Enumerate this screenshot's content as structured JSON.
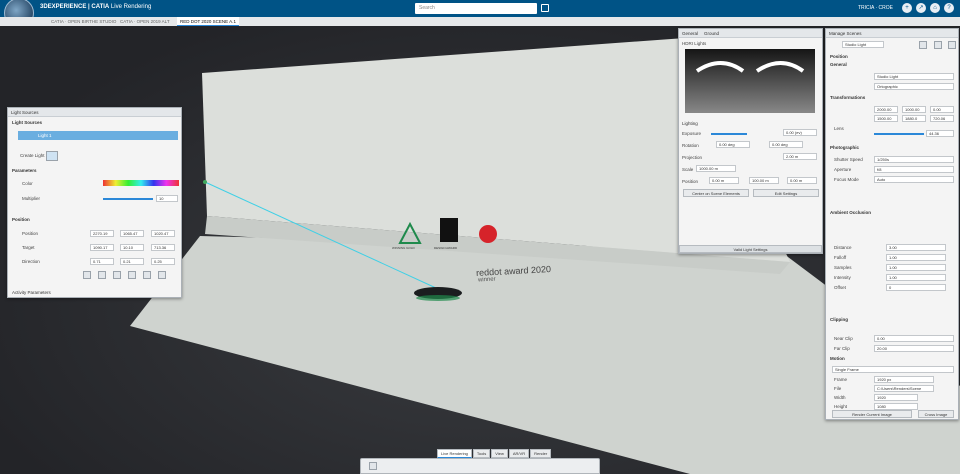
{
  "app": {
    "brand": "3DEXPERIENCE | CATIA",
    "module": "Live Rendering",
    "search_placeholder": "Search",
    "user_name": "TRICIA · CROE"
  },
  "tabs": [
    {
      "label": "CATIA · OPEN BIRTHE STUDIO"
    },
    {
      "label": "CATIA · OPEN 2019 ALT"
    },
    {
      "label": "RED DOT 2020 SCENE A.1",
      "active": true
    }
  ],
  "scene": {
    "reddot_brand": "reddot award 2020",
    "reddot_sub": "winner",
    "logo1_caption": "WINNING GOLD",
    "logo2_caption": "DESIGN AWARD"
  },
  "light_panel": {
    "title": "Light Sources",
    "section": "Light Sources",
    "light_name": "Light 1",
    "create_light_label": "Create Light",
    "parameters_heading": "Parameters",
    "color_label": "Color",
    "multiplier_label": "Multiplier",
    "multiplier_value": "10",
    "position_heading": "Position",
    "position_label": "Position",
    "target_label": "Target",
    "direction_label": "Direction",
    "position_values": [
      "2270.19",
      "1065.47",
      "1020.47"
    ],
    "target_values": [
      "1090.17",
      "10.10",
      "713.36"
    ],
    "direction_values": [
      "0.71",
      "0.21",
      "0.25"
    ],
    "advanced_heading": "Activity Parameters"
  },
  "env_panel": {
    "tab1": "General",
    "tab2": "Ground",
    "hdr_label": "HDRI Lights",
    "lighting_heading": "Lighting",
    "rows": [
      {
        "label": "Exposure",
        "value": "0.00 (ev)"
      },
      {
        "label": "Rotation",
        "value": "0.00 deg",
        "value2": "0.00 deg"
      },
      {
        "label": "Projection",
        "value": "2.00 m"
      },
      {
        "label": "Scale",
        "value": "1000.00 m"
      },
      {
        "label": "Position",
        "value": "0.00 m",
        "value2": "100.00 m",
        "value3": "0.00 m"
      }
    ],
    "btn1": "Center on Scene Elements",
    "btn2": "Edit Settings",
    "footer": "Valid Light Settings"
  },
  "props_panel": {
    "title": "Manage Scenes",
    "scene_combo": "Studio Light",
    "sections": [
      "Position",
      "General",
      "Transformations",
      "Photographic",
      "Ambient Occlusion",
      "Clipping",
      "Motion"
    ],
    "general_name": "Studio Light",
    "general_type": "Ortographic",
    "transform_values": [
      "2000.00",
      "1000.00",
      "0.00"
    ],
    "transform_values2": [
      "1500.00",
      "1880.0",
      "720.06"
    ],
    "lens_label": "Lens",
    "lens_value": "44.36",
    "photo_rows": [
      {
        "label": "Shutter Speed",
        "value": "1/250s"
      },
      {
        "label": "Aperture",
        "value": "f/8"
      },
      {
        "label": "Focus Mode",
        "value": "Auto"
      }
    ],
    "ao_rows": [
      {
        "label": "Distance",
        "value": "3.00"
      },
      {
        "label": "Falloff",
        "value": "1.00"
      },
      {
        "label": "Samples",
        "value": "1.00"
      },
      {
        "label": "Intensity",
        "value": "1.00"
      },
      {
        "label": "Offset",
        "value": "0"
      }
    ],
    "clip_rows": [
      {
        "label": "Near Clip",
        "value": "0.00"
      },
      {
        "label": "Far Clip",
        "value": "20.00"
      }
    ],
    "motion_combo": "Single Frame",
    "motion_rows": [
      {
        "label": "Frame",
        "value": "1920 px"
      },
      {
        "label": "File",
        "value": "C:\\Users\\Renders\\Scene"
      },
      {
        "label": "Width",
        "value": "1920"
      },
      {
        "label": "Height",
        "value": "1080"
      }
    ],
    "render_btn": "Render Current Image",
    "cross_btn": "Cross Image"
  },
  "bottom": {
    "tabs": [
      "Live Rendering",
      "Tools",
      "View",
      "AR/VR",
      "Render"
    ]
  },
  "colors": {
    "header": "#005386",
    "accent": "#2b88d8",
    "reddot": "#d6232a",
    "wall": "#dfe2df"
  }
}
